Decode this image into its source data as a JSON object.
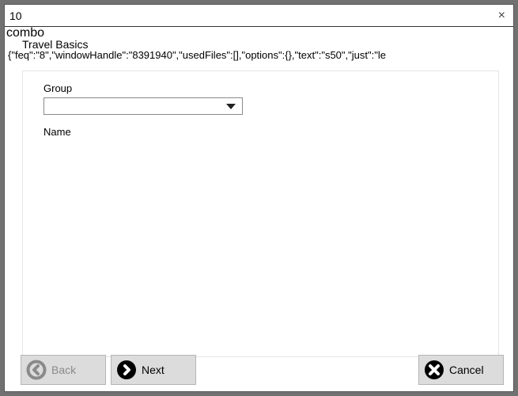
{
  "window": {
    "title": "10"
  },
  "header": {
    "combo": "combo",
    "subtitle": "Travel Basics",
    "jsonline": "{\"feq\":\"8\",\"windowHandle\":\"8391940\",\"usedFiles\":[],\"options\":{},\"text\":\"s50\",\"just\":\"le"
  },
  "form": {
    "group_label": "Group",
    "group_value": "",
    "name_label": "Name"
  },
  "buttons": {
    "back": "Back",
    "next": "Next",
    "cancel": "Cancel"
  }
}
